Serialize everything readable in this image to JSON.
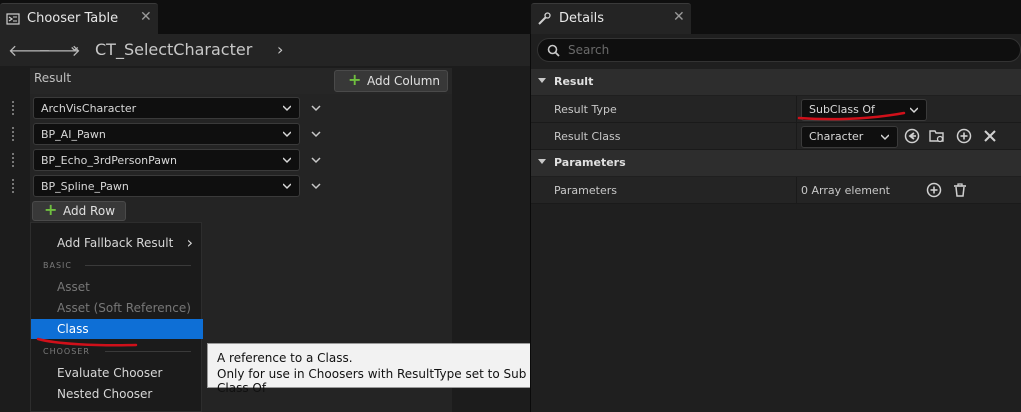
{
  "left_tab": {
    "title": "Chooser Table",
    "close_glyph": "✕"
  },
  "right_tab": {
    "title": "Details",
    "close_glyph": "✕"
  },
  "toolbar": {
    "back_glyph": "🡐",
    "forward_glyph": "🡒",
    "history_glyph": "⌄",
    "breadcrumb": "CT_SelectCharacter",
    "breadcrumb_chevron": "›"
  },
  "table": {
    "result_header": "Result",
    "add_column_label": "Add Column",
    "add_row_label": "Add Row",
    "rows": [
      {
        "value": "ArchVisCharacter"
      },
      {
        "value": "BP_AI_Pawn"
      },
      {
        "value": "BP_Echo_3rdPersonPawn"
      },
      {
        "value": "BP_Spline_Pawn"
      }
    ]
  },
  "context_menu": {
    "add_fallback": "Add Fallback Result",
    "add_fallback_arrow": "›",
    "section_basic": "BASIC",
    "item_asset": "Asset",
    "item_asset_soft": "Asset (Soft Reference)",
    "item_class": "Class",
    "section_chooser": "CHOOSER",
    "item_evaluate": "Evaluate Chooser",
    "item_nested": "Nested Chooser"
  },
  "tooltip": {
    "line1": "A reference to a Class.",
    "line2": "Only for use in Choosers with ResultType set to Sub Class Of"
  },
  "details": {
    "search_placeholder": "Search",
    "category_result": "Result",
    "prop_result_type": "Result Type",
    "prop_result_type_value": "SubClass Of",
    "prop_result_class": "Result Class",
    "prop_result_class_value": "Character",
    "category_parameters": "Parameters",
    "prop_parameters": "Parameters",
    "prop_parameters_value": "0 Array element"
  },
  "colors": {
    "accent_selection": "#0e6fd6",
    "add_green": "#6fbf3f",
    "annotation_red": "#d0101a"
  },
  "icons": [
    "chooser-table-icon",
    "details-icon",
    "search-icon",
    "plus-icon",
    "chevron-down-icon",
    "use-selected-icon",
    "browse-icon",
    "add-element-icon",
    "trash-icon",
    "clear-icon"
  ]
}
